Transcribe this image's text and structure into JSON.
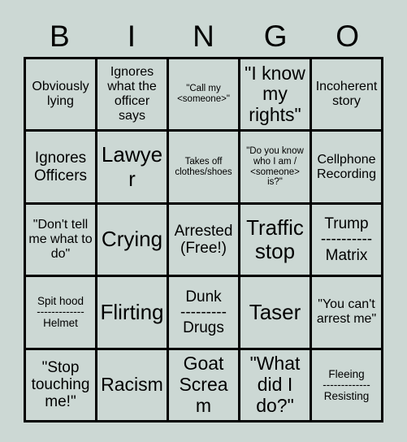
{
  "card": {
    "title": "BINGO",
    "background_color": "#ccd8d4",
    "line_color": "#000000",
    "text_color": "#000000",
    "header": [
      "B",
      "I",
      "N",
      "G",
      "O"
    ],
    "rows": [
      [
        {
          "text": "Obviously lying",
          "size": "fs-md"
        },
        {
          "text": "Ignores what the officer says",
          "size": "fs-md"
        },
        {
          "text": "\"Call my <someone>\"",
          "size": "fs-xs"
        },
        {
          "text": "\"I know my rights\"",
          "size": "fs-xl"
        },
        {
          "text": "Incoherent story",
          "size": "fs-md"
        }
      ],
      [
        {
          "text": "Ignores Officers",
          "size": "fs-lg"
        },
        {
          "text": "Lawyer",
          "size": "fs-xxl"
        },
        {
          "text": "Takes off clothes/shoes",
          "size": "fs-xs"
        },
        {
          "text": "\"Do you know who I am / <someone> is?\"",
          "size": "fs-xs"
        },
        {
          "text": "Cellphone Recording",
          "size": "fs-md"
        }
      ],
      [
        {
          "text": "\"Don't tell me what to do\"",
          "size": "fs-md"
        },
        {
          "text": "Crying",
          "size": "fs-xxl"
        },
        {
          "text": "Arrested (Free!)",
          "size": "fs-lg"
        },
        {
          "text": "Traffic stop",
          "size": "fs-xxl"
        },
        {
          "text": "Trump",
          "size": "fs-lg",
          "divider": "----------",
          "text2": "Matrix"
        }
      ],
      [
        {
          "text": "Spit hood",
          "size": "fs-sm",
          "divider": "-------------",
          "text2": "Helmet"
        },
        {
          "text": "Flirting",
          "size": "fs-xxl"
        },
        {
          "text": "Dunk",
          "size": "fs-lg",
          "divider": "---------",
          "text2": "Drugs"
        },
        {
          "text": "Taser",
          "size": "fs-xxl"
        },
        {
          "text": "\"You can't arrest me\"",
          "size": "fs-md"
        }
      ],
      [
        {
          "text": "\"Stop touching me!\"",
          "size": "fs-lg"
        },
        {
          "text": "Racism",
          "size": "fs-xl"
        },
        {
          "text": "Goat Scream",
          "size": "fs-xl"
        },
        {
          "text": "\"What did I do?\"",
          "size": "fs-xl"
        },
        {
          "text": "Fleeing",
          "size": "fs-sm",
          "divider": "-------------",
          "text2": "Resisting"
        }
      ]
    ]
  }
}
